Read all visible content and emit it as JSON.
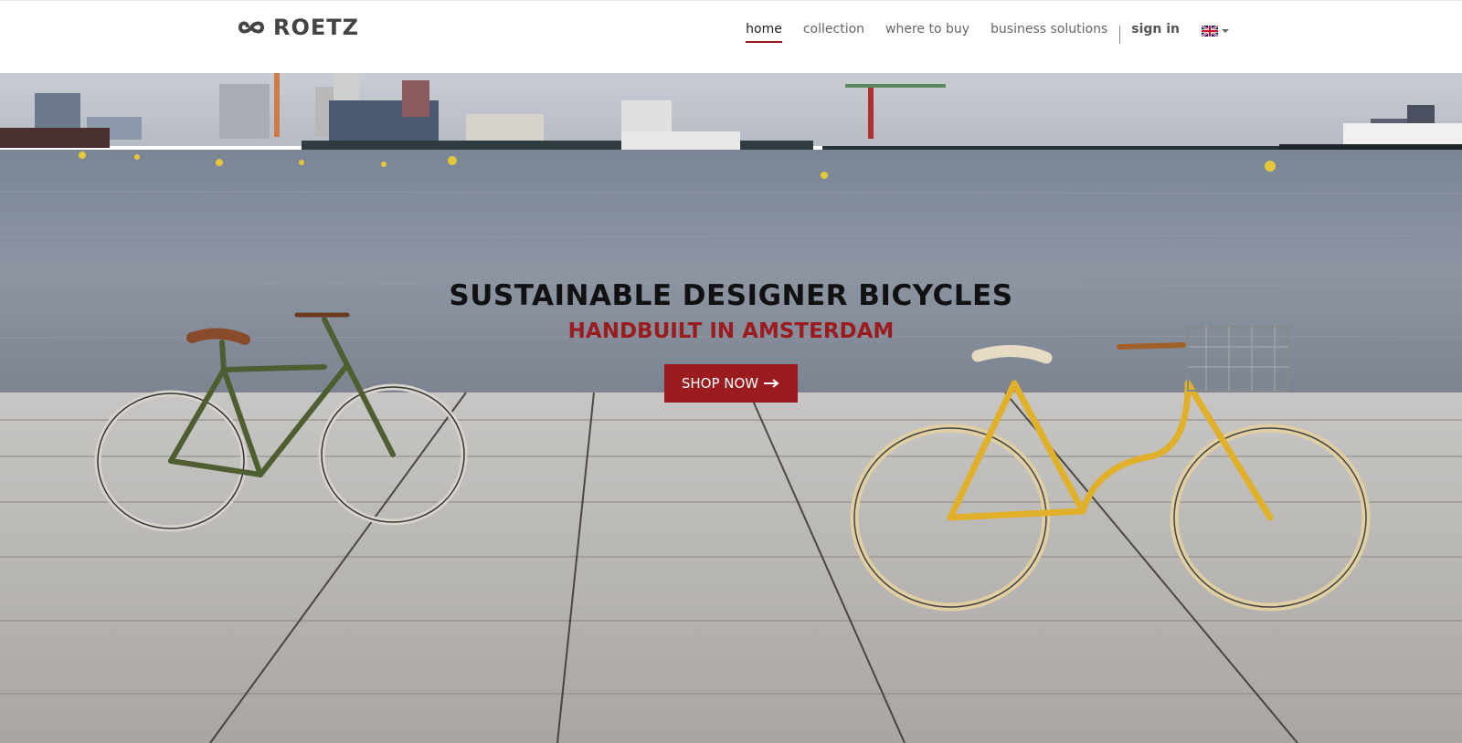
{
  "brand": {
    "name": "ROETZ",
    "accent_color": "#9b1c1f"
  },
  "nav": {
    "items": [
      {
        "label": "home",
        "active": true
      },
      {
        "label": "collection",
        "active": false
      },
      {
        "label": "where to buy",
        "active": false
      },
      {
        "label": "business solutions",
        "active": false
      }
    ],
    "sign_in": "sign in",
    "language": {
      "icon": "uk-flag-icon",
      "selected": "EN"
    }
  },
  "hero": {
    "title": "SUSTAINABLE DESIGNER BICYCLES",
    "subtitle": "HANDBUILT IN AMSTERDAM",
    "cta": {
      "label": "SHOP NOW",
      "icon": "arrow-right-icon"
    }
  }
}
